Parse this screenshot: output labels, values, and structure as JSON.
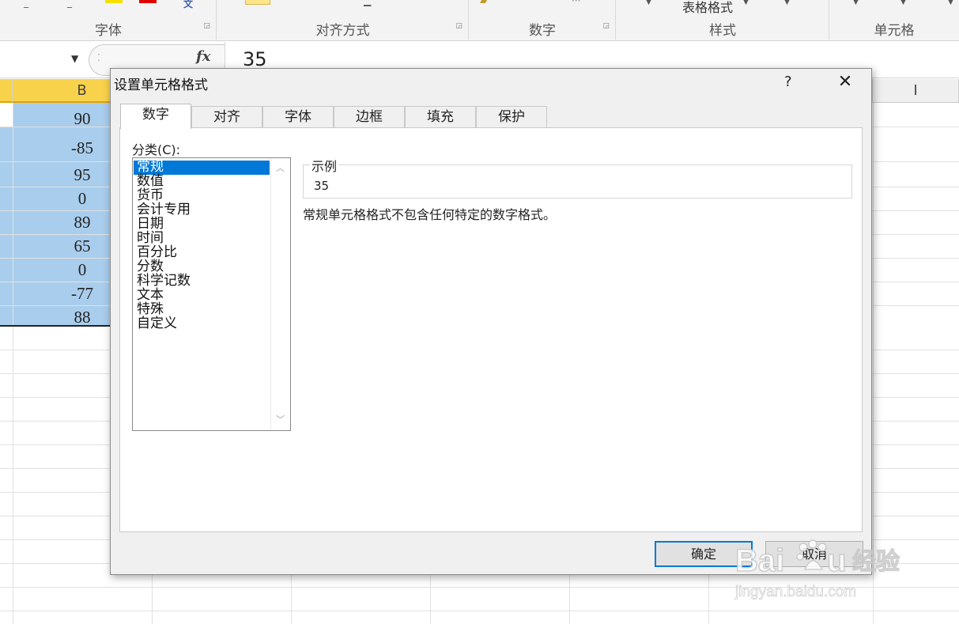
{
  "ribbon": {
    "groups": [
      {
        "label": "字体"
      },
      {
        "label": "对齐方式"
      },
      {
        "label": "数字"
      },
      {
        "label": "样式",
        "top_text": "表格格式"
      },
      {
        "label": "单元格"
      }
    ]
  },
  "formula_bar": {
    "fx_label": "fx",
    "value": "35"
  },
  "columns": {
    "selected": "B",
    "other": "I"
  },
  "cells": [
    "90",
    "-85",
    "95",
    "0",
    "89",
    "65",
    "0",
    "-77",
    "88"
  ],
  "dialog": {
    "title": "设置单元格格式",
    "help": "?",
    "close": "✕",
    "tabs": [
      "数字",
      "对齐",
      "字体",
      "边框",
      "填充",
      "保护"
    ],
    "active_tab": "数字",
    "category_label": "分类(C):",
    "categories": [
      "常规",
      "数值",
      "货币",
      "会计专用",
      "日期",
      "时间",
      "百分比",
      "分数",
      "科学记数",
      "文本",
      "特殊",
      "自定义"
    ],
    "selected_category": "常规",
    "sample_label": "示例",
    "sample_value": "35",
    "description": "常规单元格格式不包含任何特定的数字格式。",
    "ok_label": "确定",
    "cancel_label": "取消"
  },
  "watermark": {
    "brand": "Bai du 经验",
    "url": "jingyan.baidu.com"
  },
  "colors": {
    "selection": "#a9cdec",
    "header_selected": "#f8d24a",
    "list_selected": "#0078d7"
  }
}
